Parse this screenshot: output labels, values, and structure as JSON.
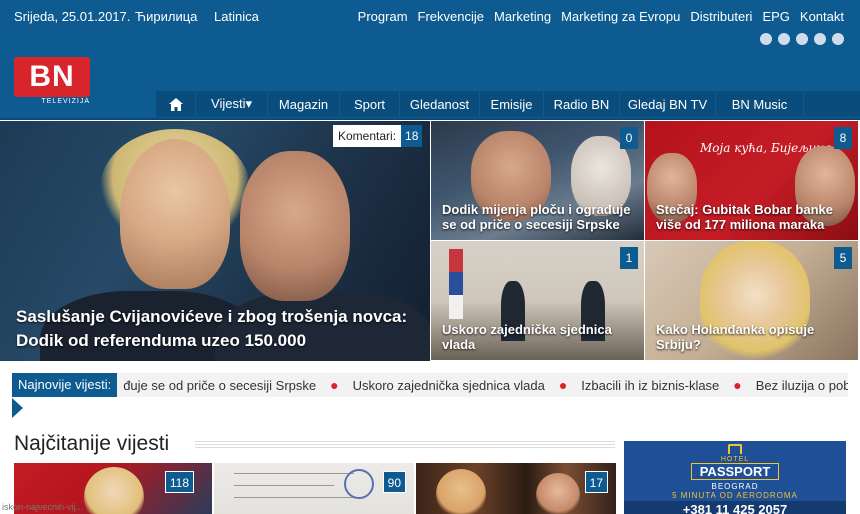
{
  "header": {
    "date": "Srijeda, 25.01.2017.",
    "script_cyrillic": "Ћирилица",
    "script_latin": "Latinica",
    "top_nav": [
      "Program",
      "Frekvencije",
      "Marketing",
      "Marketing za Evropu",
      "Distributeri",
      "EPG",
      "Kontakt"
    ],
    "social_icons": [
      "facebook-icon",
      "twitter-icon",
      "youtube-icon",
      "flickr-icon",
      "instagram-icon"
    ],
    "logo": {
      "letters": "BN",
      "sub": "TELEVIZIJA"
    },
    "main_nav": [
      {
        "label": "Vijesti▾",
        "width": 72
      },
      {
        "label": "Magazin",
        "width": 72
      },
      {
        "label": "Sport",
        "width": 60
      },
      {
        "label": "Gledanost",
        "width": 80
      },
      {
        "label": "Emisije",
        "width": 64
      },
      {
        "label": "Radio BN",
        "width": 76
      },
      {
        "label": "Gledaj BN TV",
        "width": 96
      },
      {
        "label": "BN Music",
        "width": 88
      }
    ]
  },
  "hero": {
    "title": "Saslušanje Cvijanovićeve i zbog trošenja novca: Dodik od referenduma uzeo 150.000",
    "comments_label": "Komentari:",
    "comments_count": "18"
  },
  "tiles": [
    {
      "title": "Dodik mijenja ploču i ograđuje se od priče o secesiji Srpske",
      "count": "0"
    },
    {
      "title": "Stečaj: Gubitak Bobar banke više od 177 miliona maraka",
      "count": "8",
      "image_text": "Моја кућа, Бијељина"
    },
    {
      "title": "Uskoro zajednička sjednica vlada",
      "count": "1"
    },
    {
      "title": "Kako Holanđanka opisuje Srbiju?",
      "count": "5"
    }
  ],
  "ticker": {
    "label": "Najnovije vijesti:",
    "items": [
      "đuje se od priče o secesiji Srpske",
      "Uskoro zajednička sjednica vlada",
      "Izbacili ih iz biznis-klase",
      "Bez iluzija o pob"
    ]
  },
  "section": {
    "title": "Najčitanije vijesti",
    "thumbs": [
      {
        "count": "118"
      },
      {
        "count": "90"
      },
      {
        "count": "17"
      }
    ]
  },
  "ad": {
    "hotel": "HOTEL",
    "name": "PASSPORT",
    "city": "BEOGRAD",
    "distance": "5 MINUTA OD AERODROMA",
    "phone": "+381 11 425 2057"
  },
  "status_url": "iskon-najvecnih-vij..."
}
